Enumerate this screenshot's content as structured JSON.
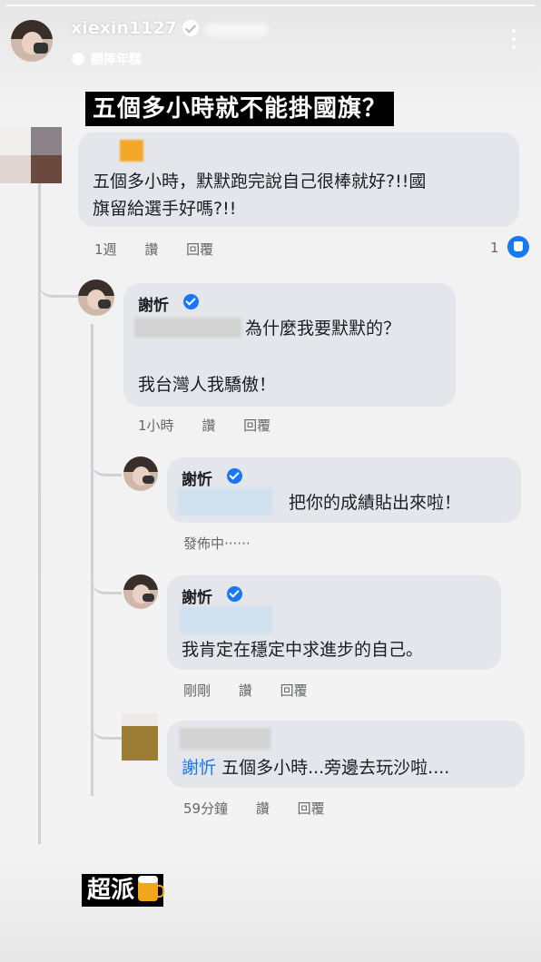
{
  "story": {
    "username": "xiexin1127",
    "music_label": "翻摔年糕",
    "headline": "五個多小時就不能掛國旗？",
    "bottom_caption": "超派"
  },
  "comments": [
    {
      "text_line1": "五個多小時，默默跑完說自己很棒就好?!!國",
      "text_line2": "旗留給選手好嗎?!!",
      "time": "1週",
      "like_label": "讚",
      "reply_label": "回覆",
      "like_count": "1"
    },
    {
      "author": "謝忻",
      "text_line1": "為什麼我要默默的？",
      "text_line2": "我台灣人我驕傲！",
      "time": "1小時",
      "like_label": "讚",
      "reply_label": "回覆"
    },
    {
      "author": "謝忻",
      "text": "把你的成績貼出來啦！",
      "status": "發佈中‧‧‧‧‧‧"
    },
    {
      "author": "謝忻",
      "text": "我肯定在穩定中求進步的自己。",
      "time": "剛剛",
      "like_label": "讚",
      "reply_label": "回覆"
    },
    {
      "tag": "謝忻",
      "text": "五個多小時...旁邊去玩沙啦....",
      "time": "59分鐘",
      "like_label": "讚",
      "reply_label": "回覆"
    }
  ],
  "colors": {
    "accent": "#1877f2",
    "bubble": "#e4e6eb",
    "meta": "#65676b"
  }
}
